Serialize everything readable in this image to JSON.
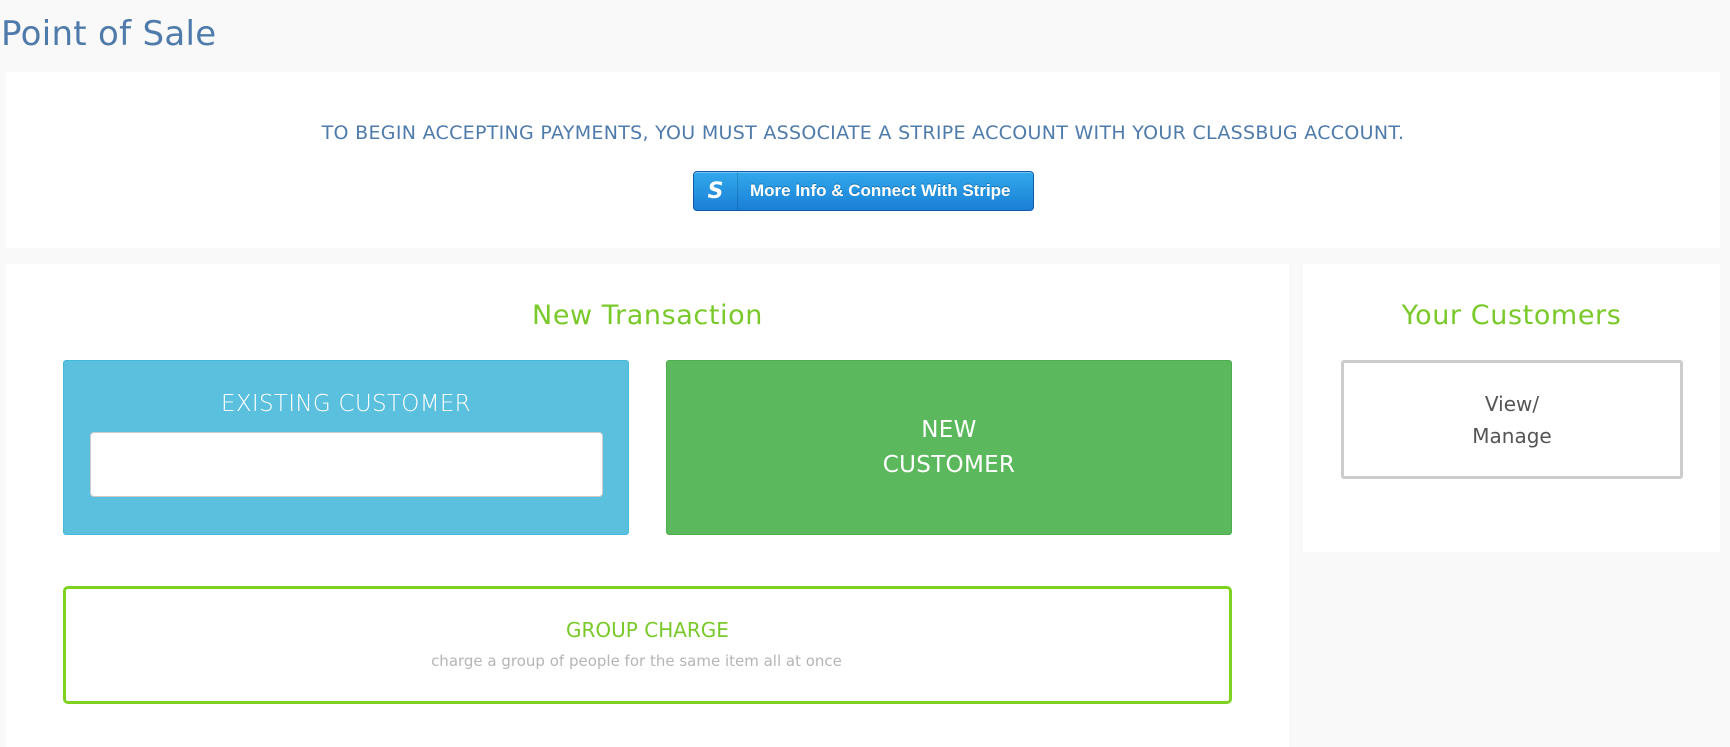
{
  "page": {
    "title": "Point of Sale"
  },
  "stripe_notice": {
    "message": "TO BEGIN ACCEPTING PAYMENTS, YOU MUST ASSOCIATE A STRIPE ACCOUNT WITH YOUR CLASSBUG ACCOUNT.",
    "button_icon_glyph": "S",
    "button_icon": "stripe-s-icon",
    "button_label": "More Info & Connect With Stripe",
    "button_color": "#1a85d9"
  },
  "new_transaction": {
    "title": "New Transaction",
    "existing_customer": {
      "label": "EXISTING CUSTOMER",
      "input_value": "",
      "input_placeholder": "",
      "color": "#5bc0de"
    },
    "new_customer": {
      "label": "NEW CUSTOMER",
      "color": "#5cb85c"
    },
    "group_charge": {
      "title": "GROUP CHARGE",
      "description": "charge a group of people for the same item all at once",
      "border_color": "#7ed321"
    }
  },
  "customers": {
    "title": "Your Customers",
    "view_manage_label": "View/ Manage"
  },
  "colors": {
    "title_blue": "#4f7bab",
    "accent_green": "#7ac92a",
    "background": "#f9f9f9"
  }
}
